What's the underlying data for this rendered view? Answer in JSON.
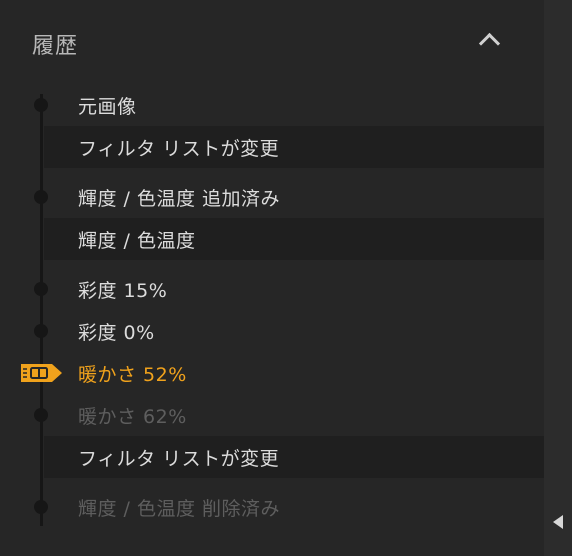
{
  "panel": {
    "title": "履歴"
  },
  "history": {
    "items": [
      {
        "label": "元画像",
        "state": "normal",
        "kind": "step"
      },
      {
        "label": "フィルタ リストが変更",
        "state": "normal",
        "kind": "group"
      },
      {
        "label": "輝度 / 色温度 追加済み",
        "state": "normal",
        "kind": "step"
      },
      {
        "label": "輝度 / 色温度",
        "state": "normal",
        "kind": "group"
      },
      {
        "label": "彩度 15%",
        "state": "normal",
        "kind": "step"
      },
      {
        "label": "彩度 0%",
        "state": "normal",
        "kind": "step"
      },
      {
        "label": "暖かさ 52%",
        "state": "current",
        "kind": "step"
      },
      {
        "label": "暖かさ 62%",
        "state": "undone",
        "kind": "step"
      },
      {
        "label": "フィルタ リストが変更",
        "state": "normal",
        "kind": "group"
      },
      {
        "label": "輝度 / 色温度 削除済み",
        "state": "undone",
        "kind": "step"
      }
    ]
  },
  "colors": {
    "accent": "#f0a21c",
    "text": "#dcdcdc",
    "dimmed": "#5e5e5e",
    "background": "#262626"
  },
  "icons": {
    "collapse": "chevron-up-icon",
    "current": "history-marker-icon",
    "side": "triangle-left-icon"
  }
}
